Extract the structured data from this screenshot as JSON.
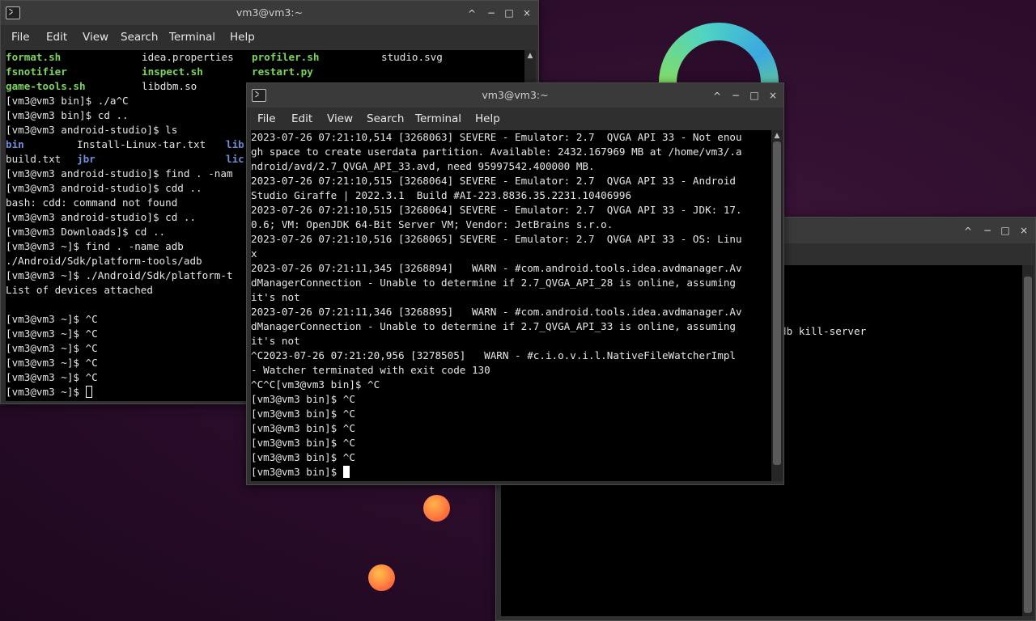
{
  "menu": [
    "File",
    "Edit",
    "View",
    "Search",
    "Terminal",
    "Help"
  ],
  "win1": {
    "title": "vm3@vm3:~",
    "ls_rows": [
      [
        {
          "t": "format.sh",
          "c": "g"
        },
        {
          "t": "idea.properties",
          "c": "y"
        },
        {
          "t": "profiler.sh",
          "c": "g"
        },
        {
          "t": "studio.svg",
          "c": "y"
        }
      ],
      [
        {
          "t": "fsnotifier",
          "c": "g"
        },
        {
          "t": "inspect.sh",
          "c": "g"
        },
        {
          "t": "restart.py",
          "c": "g"
        },
        {
          "t": "",
          "c": "y"
        }
      ],
      [
        {
          "t": "game-tools.sh",
          "c": "g"
        },
        {
          "t": "libdbm.so",
          "c": "y"
        },
        {
          "t": "",
          "c": "y"
        },
        {
          "t": "",
          "c": "y"
        }
      ]
    ],
    "lines_a": [
      "[vm3@vm3 bin]$ ./a^C",
      "[vm3@vm3 bin]$ cd ..",
      "[vm3@vm3 android-studio]$ ls"
    ],
    "ls2_rows": [
      [
        {
          "t": "bin",
          "c": "b"
        },
        {
          "t": "Install-Linux-tar.txt",
          "c": "y"
        },
        {
          "t": "lib",
          "c": "b"
        }
      ],
      [
        {
          "t": "build.txt",
          "c": "y"
        },
        {
          "t": "jbr",
          "c": "b"
        },
        {
          "t": "lic",
          "c": "b"
        }
      ]
    ],
    "lines_b": [
      "[vm3@vm3 android-studio]$ find . -nam",
      "[vm3@vm3 android-studio]$ cdd ..",
      "bash: cdd: command not found",
      "[vm3@vm3 android-studio]$ cd ..",
      "[vm3@vm3 Downloads]$ cd ..",
      "[vm3@vm3 ~]$ find . -name adb",
      "./Android/Sdk/platform-tools/adb",
      "[vm3@vm3 ~]$ ./Android/Sdk/platform-t",
      "List of devices attached",
      "",
      "[vm3@vm3 ~]$ ^C",
      "[vm3@vm3 ~]$ ^C",
      "[vm3@vm3 ~]$ ^C",
      "[vm3@vm3 ~]$ ^C",
      "[vm3@vm3 ~]$ ^C"
    ],
    "prompt": "[vm3@vm3 ~]$ "
  },
  "win2": {
    "title": "vm3@vm3:~",
    "lines": [
      "2023-07-26 07:21:10,514 [3268063] SEVERE - Emulator: 2.7  QVGA API 33 - Not enou",
      "gh space to create userdata partition. Available: 2432.167969 MB at /home/vm3/.a",
      "ndroid/avd/2.7_QVGA_API_33.avd, need 95997542.400000 MB.",
      "2023-07-26 07:21:10,515 [3268064] SEVERE - Emulator: 2.7  QVGA API 33 - Android",
      "Studio Giraffe | 2022.3.1  Build #AI-223.8836.35.2231.10406996",
      "2023-07-26 07:21:10,515 [3268064] SEVERE - Emulator: 2.7  QVGA API 33 - JDK: 17.",
      "0.6; VM: OpenJDK 64-Bit Server VM; Vendor: JetBrains s.r.o.",
      "2023-07-26 07:21:10,516 [3268065] SEVERE - Emulator: 2.7  QVGA API 33 - OS: Linu",
      "x",
      "2023-07-26 07:21:11,345 [3268894]   WARN - #com.android.tools.idea.avdmanager.Av",
      "dManagerConnection - Unable to determine if 2.7_QVGA_API_28 is online, assuming",
      "it's not",
      "2023-07-26 07:21:11,346 [3268895]   WARN - #com.android.tools.idea.avdmanager.Av",
      "dManagerConnection - Unable to determine if 2.7_QVGA_API_33 is online, assuming",
      "it's not",
      "^C2023-07-26 07:21:20,956 [3278505]   WARN - #c.i.o.v.i.l.NativeFileWatcherImpl",
      "- Watcher terminated with exit code 130",
      "^C^C[vm3@vm3 bin]$ ^C",
      "[vm3@vm3 bin]$ ^C",
      "[vm3@vm3 bin]$ ^C",
      "[vm3@vm3 bin]$ ^C",
      "[vm3@vm3 bin]$ ^C",
      "[vm3@vm3 bin]$ ^C"
    ],
    "prompt": "[vm3@vm3 bin]$ "
  },
  "win3": {
    "visible_text": "db kill-server"
  },
  "buttons": {
    "minimize": "−",
    "maximize": "□",
    "close": "×",
    "keep_above": "^"
  }
}
